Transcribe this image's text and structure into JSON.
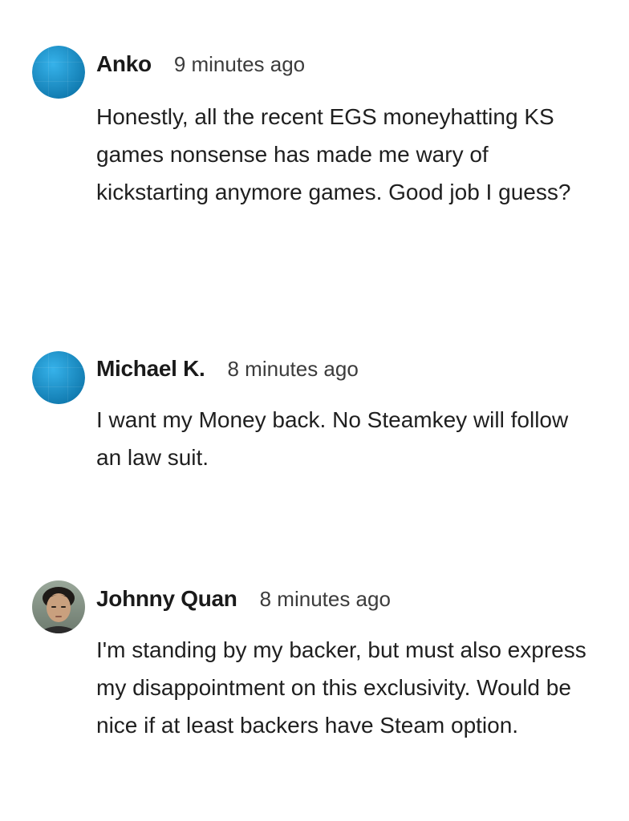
{
  "comments": [
    {
      "author": "Anko",
      "time": "9 minutes ago",
      "avatar_icon": "blue-circle-avatar",
      "text": "Honestly, all the recent EGS moneyhatting KS games nonsense has made me wary of kickstarting anymore games. Good job I guess?"
    },
    {
      "author": "Michael K.",
      "time": "8 minutes ago",
      "avatar_icon": "blue-circle-avatar",
      "text": "I want my Money back. No Steamkey will follow an law suit."
    },
    {
      "author": "Johnny Quan",
      "time": "8 minutes ago",
      "avatar_icon": "photo-avatar",
      "text": "I'm standing by my backer, but must also express my disappointment on this exclusivity. Would be nice if at least backers have Steam option."
    }
  ],
  "colors": {
    "avatar_blue": "#1e9bd7",
    "avatar_blue_dark": "#0f78ad",
    "text": "#1f1f1f",
    "meta": "#3c3c3c"
  }
}
